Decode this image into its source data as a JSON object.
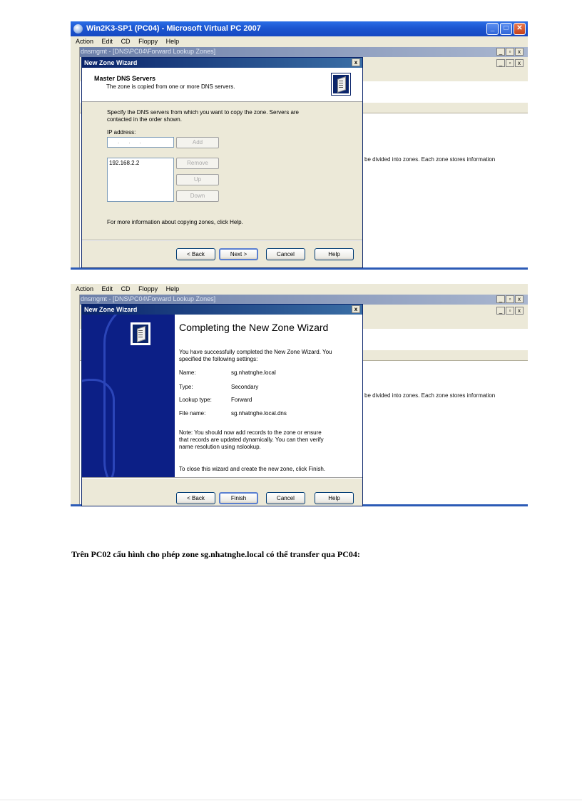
{
  "vpc": {
    "title": "Win2K3-SP1 (PC04) - Microsoft Virtual PC 2007",
    "minimize": "_",
    "maximize": "□",
    "close": "✕"
  },
  "menu": [
    "Action",
    "Edit",
    "CD",
    "Floppy",
    "Help"
  ],
  "mmc": {
    "title": "dnsmgmt - [DNS\\PC04\\Forward Lookup Zones]",
    "min": "_",
    "max": "▫",
    "close": "x",
    "zone_text": "be divided into zones. Each zone stores information"
  },
  "wizard1": {
    "title": "New Zone Wizard",
    "close": "x",
    "header_title": "Master DNS Servers",
    "header_sub": "The zone is copied from one or more DNS servers.",
    "instructions_1": "Specify the DNS servers from which you want to copy the zone. Servers are",
    "instructions_2": "contacted in the order shown.",
    "ip_label": "IP address:",
    "ip_input": "...",
    "ip_list": [
      "192.168.2.2"
    ],
    "add": "Add",
    "remove": "Remove",
    "up": "Up",
    "down": "Down",
    "more_info": "For more information about copying zones, click Help.",
    "back": "< Back",
    "next": "Next >",
    "cancel": "Cancel",
    "help": "Help"
  },
  "wizard2": {
    "title": "New Zone Wizard",
    "close": "x",
    "heading": "Completing the New Zone Wizard",
    "intro_1": "You have successfully completed the New Zone Wizard. You",
    "intro_2": "specified the following settings:",
    "settings": [
      {
        "key": "Name:",
        "value": "sg.nhatnghe.local"
      },
      {
        "key": "Type:",
        "value": "Secondary"
      },
      {
        "key": "Lookup type:",
        "value": "Forward"
      },
      {
        "key": "File name:",
        "value": "sg.nhatnghe.local.dns"
      }
    ],
    "note_1": "Note: You should now add records to the zone or ensure",
    "note_2": "that records are updated dynamically. You can then verify",
    "note_3": "name resolution using nslookup.",
    "close_text": "To close this wizard and create the new zone, click Finish.",
    "back": "< Back",
    "finish": "Finish",
    "cancel": "Cancel",
    "help": "Help"
  },
  "caption": "Trên PC02 cấu hình cho phép zone sg.nhatnghe.local có thể transfer qua PC04:"
}
